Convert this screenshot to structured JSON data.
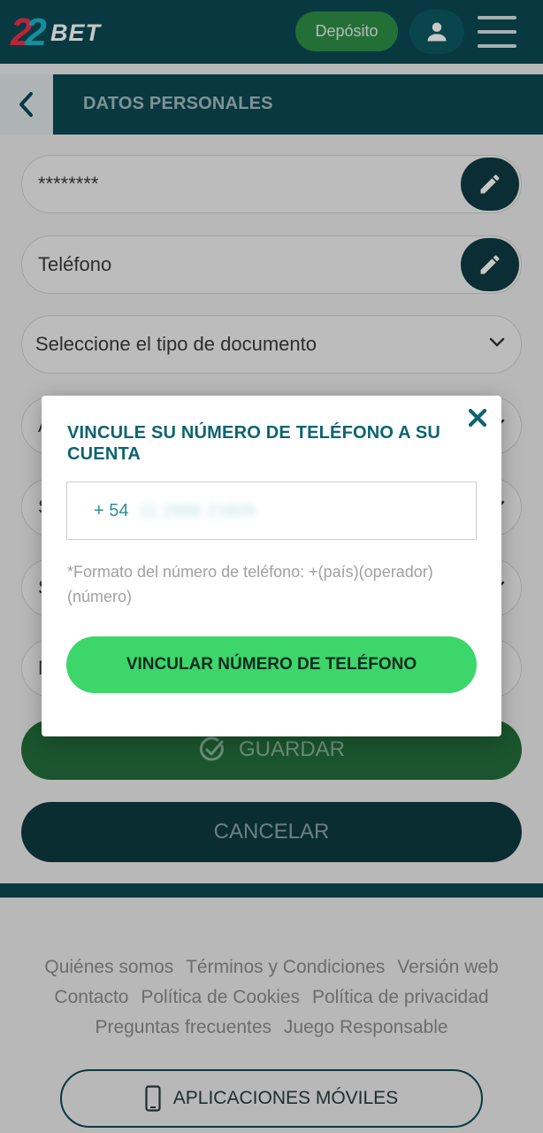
{
  "header": {
    "logo_number": "22",
    "logo_text": "BET",
    "deposit_label": "Depósito",
    "user_icon": "user-icon",
    "menu_icon": "hamburger-menu-icon"
  },
  "subheader": {
    "back_icon": "chevron-left-icon",
    "title": "DATOS PERSONALES"
  },
  "form": {
    "password_value": "********",
    "phone_value": "Teléfono",
    "document_select": "Seleccione el tipo de documento",
    "stub_letters": [
      "A",
      "S",
      "S",
      "N"
    ],
    "save_label": "GUARDAR",
    "cancel_label": "CANCELAR"
  },
  "modal": {
    "title": "VINCULE SU NÚMERO DE TELÉFONO A SU CUENTA",
    "phone_prefix": "+ 54",
    "phone_number_blurred": "11 2986 21609",
    "hint": "*Formato del número de teléfono: +(país)(operador)(número)",
    "submit_label": "VINCULAR NÚMERO DE TELÉFONO",
    "close_icon": "close-icon"
  },
  "footer": {
    "links": [
      [
        "Quiénes somos",
        "Términos y Condiciones",
        "Versión web"
      ],
      [
        "Contacto",
        "Política de Cookies",
        "Política de privacidad"
      ],
      [
        "Preguntas frecuentes",
        "Juego Responsable"
      ]
    ],
    "apps_label": "APLICACIONES MÓVILES"
  },
  "colors": {
    "brand_dark": "#0b4a52",
    "accent_green": "#3dd66b",
    "title_teal": "#0b6470"
  }
}
